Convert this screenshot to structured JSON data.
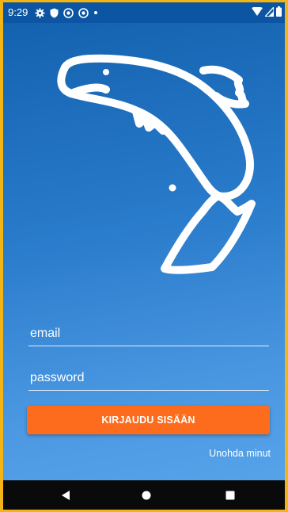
{
  "status_bar": {
    "time": "9:29",
    "left_icons": [
      "gear-icon",
      "shield-icon",
      "vpn-icon",
      "vpn-icon",
      "dot-icon"
    ],
    "right_icons": [
      "wifi-icon",
      "signal-icon",
      "battery-icon"
    ]
  },
  "logo": {
    "icon": "fish-logo-icon"
  },
  "form": {
    "email_placeholder": "email",
    "password_placeholder": "password",
    "login_label": "KIRJAUDU SISÄÄN",
    "forgot_label": "Unohda minut"
  },
  "colors": {
    "gradient_top": "#1160ad",
    "gradient_bottom": "#5aa6ec",
    "button": "#fd6b1c",
    "frame_border": "#f2b515"
  },
  "nav_bar": {
    "icons": [
      "back-icon",
      "home-icon",
      "recent-apps-icon"
    ]
  }
}
